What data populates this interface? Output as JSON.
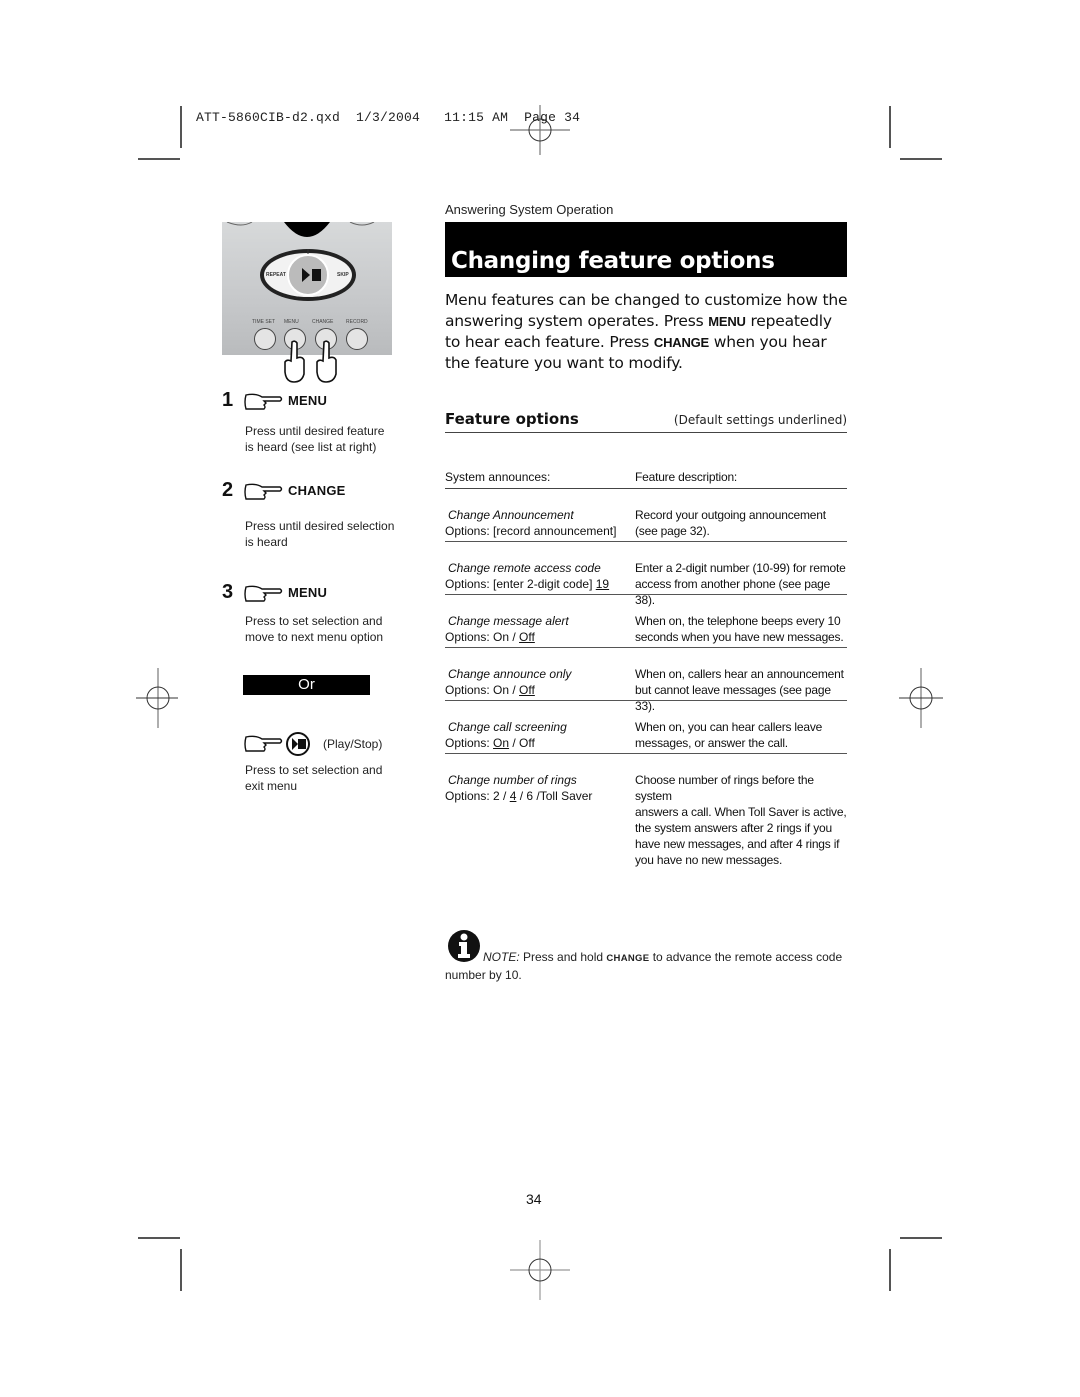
{
  "print_slug": {
    "file": "ATT-5860CIB-d2.qxd",
    "date": "1/3/2004",
    "time": "11:15 AM",
    "page": "Page 34"
  },
  "keypad": {
    "buttons": [
      "TIME SET",
      "MENU",
      "CHANGE",
      "RECORD"
    ],
    "dial": {
      "left": "REPEAT",
      "center": "▶/■",
      "right": "SKIP"
    }
  },
  "steps": [
    {
      "number": "1",
      "key": "MENU",
      "text_lines": [
        "Press until desired feature",
        "is heard (see list at right)"
      ]
    },
    {
      "number": "2",
      "key": "CHANGE",
      "text_lines": [
        "Press until desired selection",
        "is heard"
      ]
    },
    {
      "number": "3",
      "key": "MENU",
      "text_lines": [
        "Press to set selection and",
        "move  to next menu option"
      ]
    }
  ],
  "or_label": "Or",
  "play_stop": {
    "label": "(Play/Stop)",
    "text_lines": [
      "Press to set selection and",
      "exit  menu"
    ]
  },
  "section_label": "Answering System Operation",
  "title": "Changing feature options",
  "intro": {
    "part1": "Menu features can be changed to customize how the answering system operates. Press ",
    "key1": "MENU",
    "part2": " repeatedly to hear each feature. Press ",
    "key2": "CHANGE",
    "part3": " when you hear the feature you want to modify."
  },
  "feature_options": {
    "heading": "Feature options",
    "note": "(Default settings underlined)",
    "col_headers": [
      "System announces:",
      "Feature description:"
    ],
    "rows": [
      {
        "name": "Change Announcement",
        "options_prefix": "Options: [record announcement]",
        "options_parts": [],
        "description": [
          "Record your outgoing announcement",
          "(see page 32)."
        ]
      },
      {
        "name": "Change remote access code",
        "options_prefix": "Options: [enter 2-digit code] ",
        "default": "19",
        "description": [
          "Enter a 2-digit number (10-99) for remote",
          "access from another phone (see page 38)."
        ]
      },
      {
        "name": "Change message alert",
        "options_prefix": "Options: On / ",
        "default": "Off",
        "description": [
          "When on, the telephone beeps every 10",
          "seconds when you have new messages."
        ]
      },
      {
        "name": "Change announce only",
        "options_prefix": "Options: On / ",
        "default": "Off",
        "description": [
          "When on, callers hear an announcement",
          "but cannot leave messages (see page 33)."
        ]
      },
      {
        "name": "Change call screening",
        "options_prefix": "Options: ",
        "default": "On",
        "options_suffix": " / Off",
        "description": [
          "When on, you can hear callers leave",
          "messages, or answer the call."
        ]
      },
      {
        "name": "Change number of rings",
        "options_prefix": "Options: 2 / ",
        "default": "4",
        "options_suffix": " / 6 /Toll Saver",
        "description": [
          "Choose number of rings before the system",
          "answers a call. When Toll Saver is active,",
          "the system answers after 2 rings if you",
          "have new messages, and after 4 rings if",
          "you have no new messages."
        ]
      }
    ]
  },
  "note": {
    "label": "NOTE:",
    "text1": " Press and hold ",
    "key": "CHANGE",
    "text2": " to advance the remote access code number by 10."
  },
  "page_number": "34"
}
